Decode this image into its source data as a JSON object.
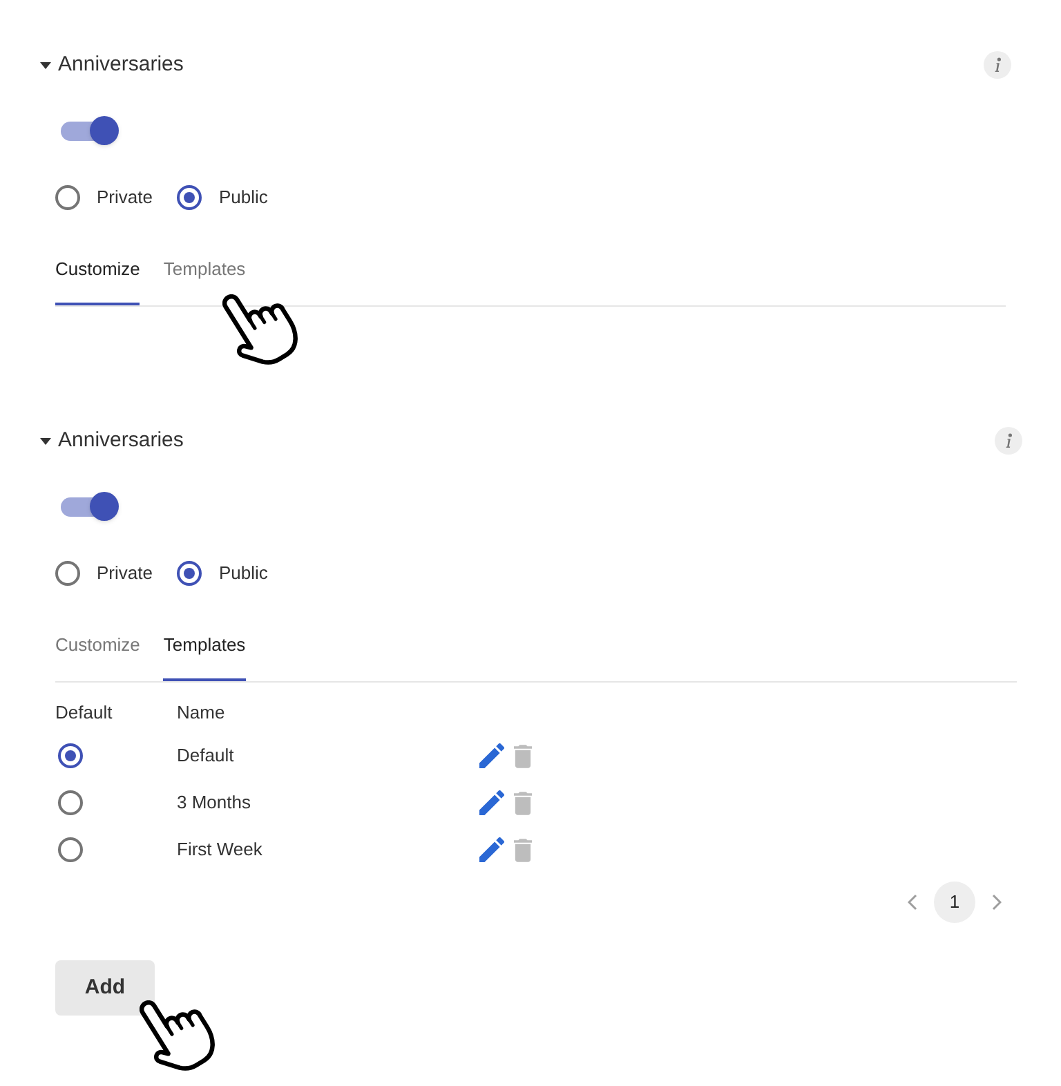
{
  "sections": [
    {
      "title": "Anniversaries",
      "expanded": true,
      "enabled": true,
      "visibility": [
        {
          "label": "Private",
          "selected": false
        },
        {
          "label": "Public",
          "selected": true
        }
      ],
      "tabs": [
        {
          "label": "Customize",
          "selected": true,
          "hovered": false
        },
        {
          "label": "Templates",
          "selected": false,
          "hovered": true
        }
      ]
    },
    {
      "title": "Anniversaries",
      "expanded": true,
      "enabled": true,
      "visibility": [
        {
          "label": "Private",
          "selected": false
        },
        {
          "label": "Public",
          "selected": true
        }
      ],
      "tabs": [
        {
          "label": "Customize",
          "selected": false,
          "hovered": false
        },
        {
          "label": "Templates",
          "selected": true,
          "hovered": false
        }
      ],
      "templates": {
        "columns": [
          "Default",
          "Name"
        ],
        "rows": [
          {
            "name": "Default",
            "selected": true
          },
          {
            "name": "3 Months",
            "selected": false
          },
          {
            "name": "First Week",
            "selected": false
          }
        ],
        "pages": [
          {
            "label": "1",
            "selected": true
          }
        ],
        "add_button": {
          "label": "Add",
          "hovered": true
        }
      }
    }
  ]
}
